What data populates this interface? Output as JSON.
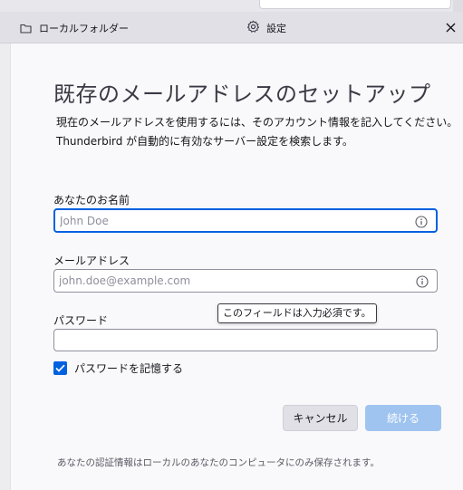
{
  "tabs": {
    "folder_label": "ローカルフォルダー",
    "settings_label": "設定"
  },
  "account_setup": {
    "title": "既存のメールアドレスのセットアップ",
    "description_line1": "現在のメールアドレスを使用するには、そのアカウント情報を記入してください。",
    "description_line2": "Thunderbird が自動的に有効なサーバー設定を検索します。"
  },
  "fields": {
    "name": {
      "label": "あなたのお名前",
      "placeholder": "John Doe",
      "value": ""
    },
    "email": {
      "label": "メールアドレス",
      "placeholder": "john.doe@example.com",
      "value": ""
    },
    "password": {
      "label": "パスワード",
      "placeholder": "",
      "value": ""
    }
  },
  "tooltip": {
    "text": "このフィールドは入力必須です。"
  },
  "remember_password": {
    "label": "パスワードを記憶する",
    "checked": true
  },
  "buttons": {
    "cancel": "キャンセル",
    "continue": "続ける"
  },
  "footnote": "あなたの認証情報はローカルのあなたのコンピュータにのみ保存されます。",
  "colors": {
    "accent": "#0061e0",
    "continue_disabled": "#a0c4f0"
  },
  "icons": {
    "folder": "folder-icon",
    "settings": "gear-icon",
    "close": "close-icon",
    "info": "info-icon",
    "check": "checkmark-icon"
  }
}
